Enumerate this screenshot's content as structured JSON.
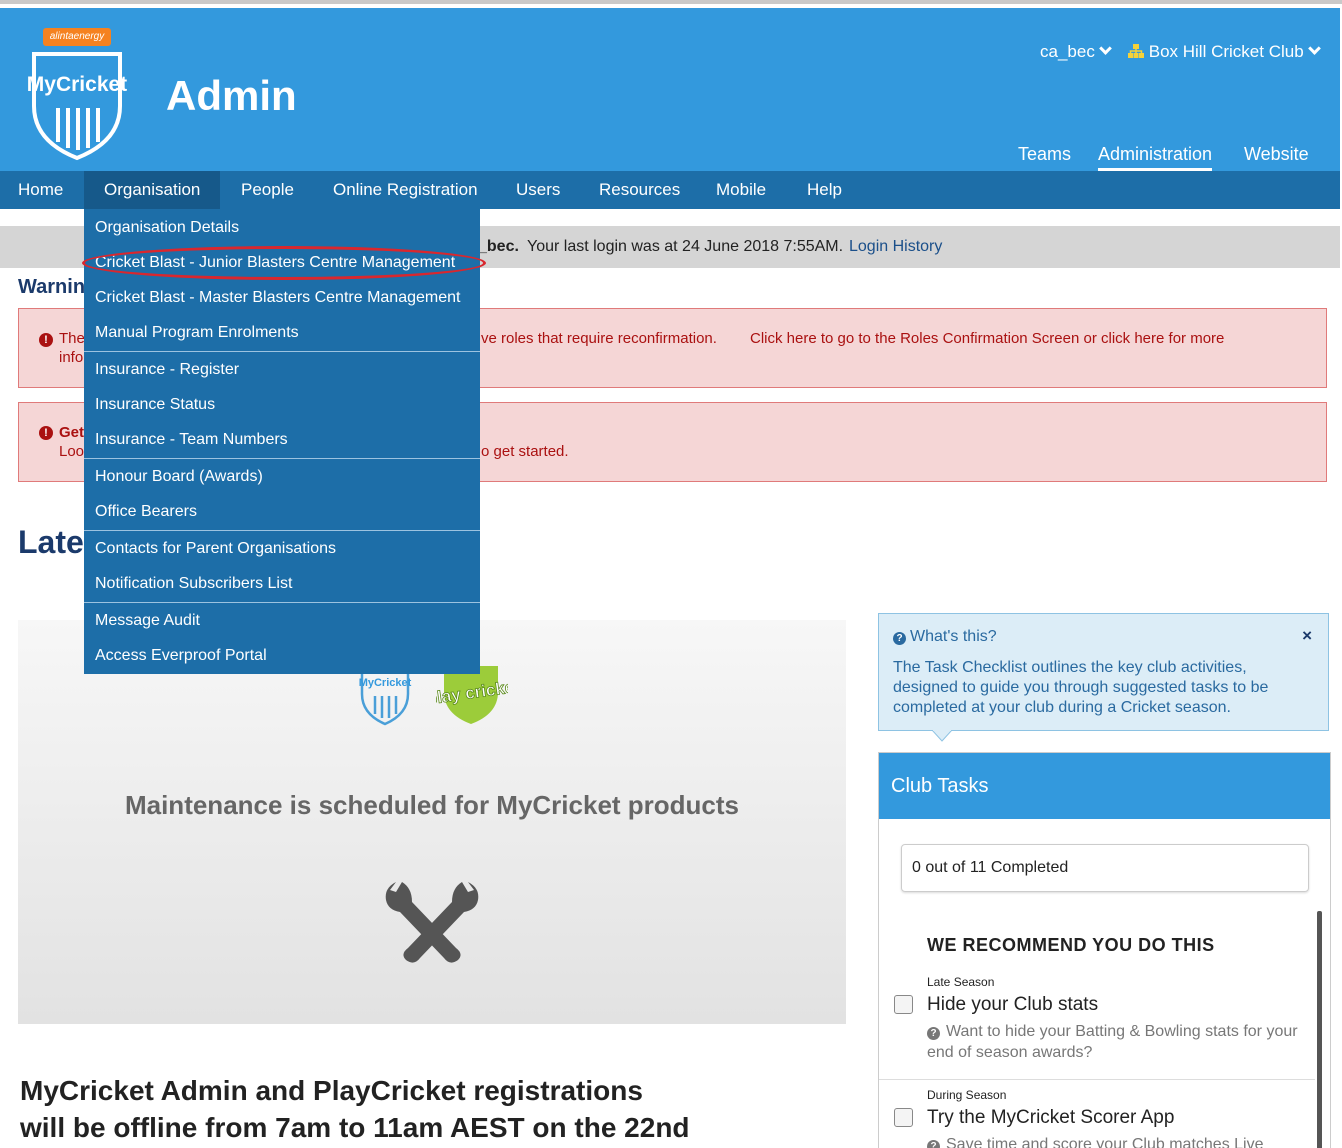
{
  "header": {
    "brand_badge": "alintaenergy",
    "logo_text": "MyCricket",
    "title": "Admin",
    "user_label": "ca_bec",
    "club_label": "Box Hill Cricket Club",
    "tabs": [
      {
        "label": "Teams",
        "active": false
      },
      {
        "label": "Administration",
        "active": true
      },
      {
        "label": "Website",
        "active": false
      }
    ],
    "colors": {
      "header_bg": "#3399dd",
      "nav_bg": "#1d6ea8"
    }
  },
  "nav": {
    "items": [
      "Home",
      "Organisation",
      "People",
      "Online Registration",
      "Users",
      "Resources",
      "Mobile",
      "Help"
    ],
    "open_item": "Organisation"
  },
  "dropdown": {
    "items": [
      "Organisation Details",
      "Cricket Blast - Junior Blasters Centre Management",
      "Cricket Blast - Master Blasters Centre Management",
      "Manual Program Enrolments",
      "Insurance - Register",
      "Insurance Status",
      "Insurance - Team Numbers",
      "Honour Board (Awards)",
      "Office Bearers",
      "Contacts for Parent Organisations",
      "Notification Subscribers List",
      "Message Audit",
      "Access Everproof Portal"
    ],
    "highlighted": "Cricket Blast - Junior Blasters Centre Management"
  },
  "login_bar": {
    "user_fragment": "_bec.",
    "last_login": "Your last login was at 24 June 2018 7:55AM.",
    "history_link": "Login History"
  },
  "warnings": {
    "heading": "Warnin",
    "alert1_line1_start": "The",
    "alert1_line1_end": "ve roles that require reconfirmation.",
    "alert1_link": "Click here to go to the Roles Confirmation Screen or click here for more",
    "alert1_line2": "info",
    "alert2_line1": "Get",
    "alert2_line2_start": "Loo",
    "alert2_line2_end": "o get started."
  },
  "latest_heading": "Late",
  "maintenance": {
    "title": "Maintenance is scheduled for MyCricket products",
    "logo1": "MyCricket",
    "logo2": "play cricket"
  },
  "news": {
    "title_line1": "MyCricket Admin and PlayCricket registrations",
    "title_line2": "will be offline from 7am to 11am AEST on the 22nd"
  },
  "help": {
    "question": "What's this?",
    "close": "×",
    "text": "The Task Checklist outlines the key club activities, designed to guide you through suggested tasks to be completed at your club during a Cricket season."
  },
  "tasks": {
    "heading": "Club Tasks",
    "progress": "0 out of 11 Completed",
    "recommend": "WE RECOMMEND YOU DO THIS",
    "items": [
      {
        "phase": "Late Season",
        "name": "Hide your Club stats",
        "desc": "Want to hide your Batting & Bowling stats for your end of season awards?",
        "checked": false
      },
      {
        "phase": "During Season",
        "name": "Try the MyCricket Scorer App",
        "desc": "Save time and score your Club matches Live",
        "checked": false
      }
    ]
  }
}
